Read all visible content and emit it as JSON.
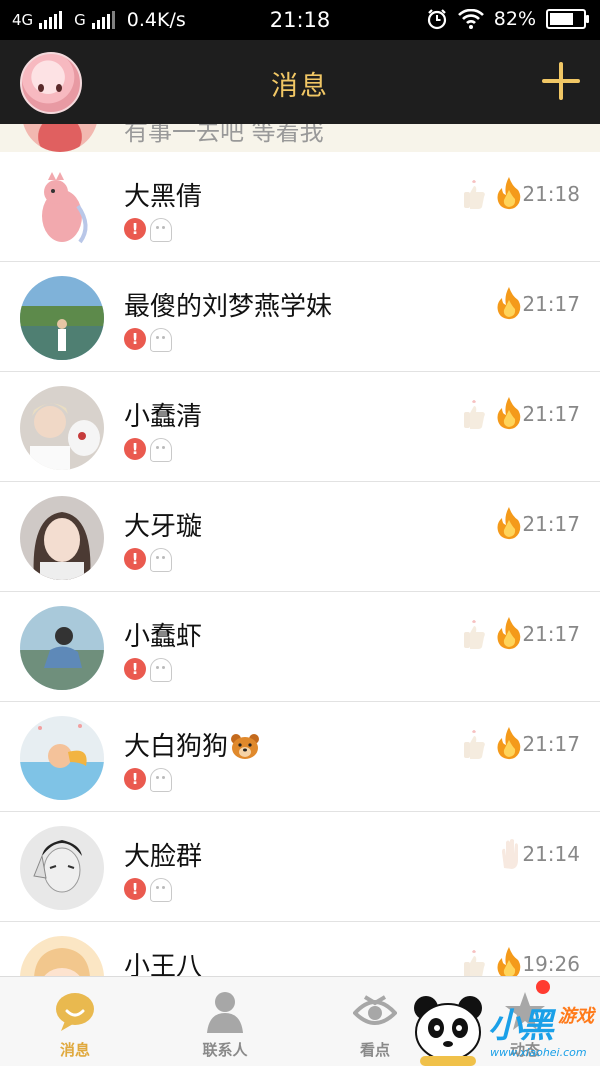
{
  "status_bar": {
    "network_1": "4G",
    "network_2": "G",
    "speed": "0.4K/s",
    "time": "21:18",
    "battery": "82%",
    "battery_level": 0.82
  },
  "header": {
    "title": "消息",
    "title_color": "#f1c765"
  },
  "pinned": {
    "preview": "有事一去吧 等着我"
  },
  "conversations": [
    {
      "name": "大黑倩",
      "time": "21:18",
      "flame": true,
      "thumb": true
    },
    {
      "name": "最傻的刘梦燕学妹",
      "time": "21:17",
      "flame": true,
      "thumb": false
    },
    {
      "name": "小蠢清",
      "time": "21:17",
      "flame": true,
      "thumb": true
    },
    {
      "name": "大牙璇",
      "time": "21:17",
      "flame": true,
      "thumb": false
    },
    {
      "name": "小蠢虾",
      "time": "21:17",
      "flame": true,
      "thumb": true
    },
    {
      "name": "大白狗狗",
      "time": "21:17",
      "flame": true,
      "thumb": true,
      "emoji": "bear-face"
    },
    {
      "name": "大脸群",
      "time": "21:14",
      "flame": false,
      "thumb": true
    },
    {
      "name": "小王八",
      "time": "19:26",
      "flame": true,
      "thumb": true
    }
  ],
  "badges": {
    "alert": "!"
  },
  "tabs": [
    {
      "label": "消息",
      "icon": "chat-bubble-icon",
      "active": true
    },
    {
      "label": "联系人",
      "icon": "person-icon",
      "active": false
    },
    {
      "label": "看点",
      "icon": "eye-icon",
      "active": false
    },
    {
      "label": "动态",
      "icon": "star-icon",
      "active": false
    }
  ],
  "watermark": {
    "text": "小黑",
    "sub": "游戏",
    "url": "www.xiaohei.com"
  }
}
